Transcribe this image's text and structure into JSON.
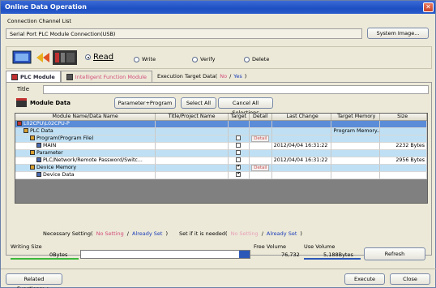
{
  "window": {
    "title": "Online Data Operation",
    "close_glyph": "✕"
  },
  "connection": {
    "group_label": "Connection Channel List",
    "channel": "Serial Port  PLC Module Connection(USB)",
    "system_image_button": "System Image..."
  },
  "operations": [
    {
      "label": "Read",
      "selected": true
    },
    {
      "label": "Write",
      "selected": false
    },
    {
      "label": "Verify",
      "selected": false
    },
    {
      "label": "Delete",
      "selected": false
    }
  ],
  "tabs": {
    "plc_module": "PLC Module",
    "intelligent": "Intelligent Function Module",
    "execution_target_label": "Execution Target Data(",
    "no": "No",
    "slash": "/",
    "yes": "Yes",
    "close_paren": ")"
  },
  "title_label": "Title",
  "module_data": {
    "label": "Module Data",
    "param_program_button": "Parameter+Program",
    "select_all_button": "Select All",
    "cancel_all_button": "Cancel All Selections"
  },
  "grid": {
    "columns": [
      "Module Name/Data Name",
      "Title/Project Name",
      "Target",
      "Detail",
      "Last Change",
      "Target Memory",
      "Size"
    ],
    "rows": [
      {
        "style": "sel",
        "name": "L02CPU\\L02CPU-P",
        "title": "",
        "target": "",
        "detail": "",
        "change": "",
        "memory": "",
        "size": "",
        "indent": 0
      },
      {
        "style": "grp",
        "name": "PLC Data",
        "title": "",
        "target": "",
        "detail": "",
        "change": "",
        "memory": "Program Memory...",
        "size": "",
        "indent": 1
      },
      {
        "style": "grp",
        "name": "Program(Program File)",
        "title": "",
        "target": "off",
        "detail": "Detail",
        "change": "",
        "memory": "",
        "size": "",
        "indent": 2
      },
      {
        "style": "plain",
        "name": "MAIN",
        "title": "",
        "target": "off",
        "detail": "",
        "change": "2012/04/04 16:31:22",
        "memory": "",
        "size": "2232 Bytes",
        "indent": 3
      },
      {
        "style": "grp",
        "name": "Parameter",
        "title": "",
        "target": "off",
        "detail": "",
        "change": "",
        "memory": "",
        "size": "",
        "indent": 2
      },
      {
        "style": "plain",
        "name": "PLC/Network/Remote Password/Switc...",
        "title": "",
        "target": "off",
        "detail": "",
        "change": "2012/04/04 16:31:22",
        "memory": "",
        "size": "2956 Bytes",
        "indent": 3
      },
      {
        "style": "grp",
        "name": "Device Memory",
        "title": "",
        "target": "on",
        "detail": "Detail",
        "change": "",
        "memory": "",
        "size": "",
        "indent": 2
      },
      {
        "style": "plain",
        "name": "Device Data",
        "title": "",
        "target": "on",
        "detail": "",
        "change": "",
        "memory": "",
        "size": "",
        "indent": 3
      }
    ]
  },
  "legend": {
    "necessary": "Necessary Setting(",
    "no_setting": "No Setting",
    "sep": "/",
    "already_set": "Already Set",
    "close": ")",
    "set_if": "Set if it is needed(",
    "no_setting2": "No Setting",
    "sep2": "/",
    "already_set2": "Already Set",
    "close2": ")"
  },
  "sizes": {
    "writing_size_label": "Writing Size",
    "writing_size_value": "0Bytes",
    "free_volume_label": "Free Volume",
    "free_volume_value": "76,732",
    "use_volume_label": "Use Volume",
    "use_volume_value": "5,188Bytes",
    "refresh_button": "Refresh",
    "bar_fill_fraction": 0.063
  },
  "footer": {
    "related_functions": "Related Functions>>",
    "execute": "Execute",
    "close": "Close"
  },
  "colors": {
    "title_bar": "#1e4fc2",
    "selected_row": "#5a8cd8",
    "group_row": "#bfe0f4",
    "no_setting": "#d24c7a",
    "already_set": "#1a3cb8"
  }
}
